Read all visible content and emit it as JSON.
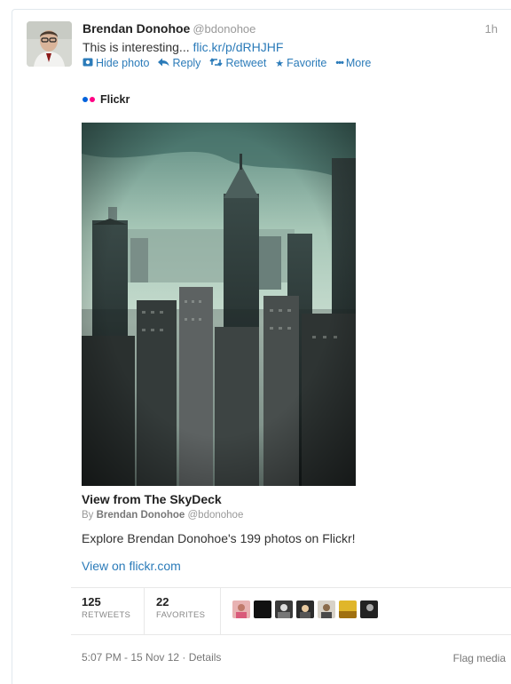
{
  "tweet": {
    "author_name": "Brendan Donohoe",
    "author_handle": "@bdonohoe",
    "time_ago": "1h",
    "text_prefix": "This is interesting... ",
    "link_text": "flic.kr/p/dRHJHF",
    "avatar_icon": "person-avatar"
  },
  "actions": {
    "hide_photo": "Hide photo",
    "reply": "Reply",
    "retweet": "Retweet",
    "favorite": "Favorite",
    "more": "More"
  },
  "card": {
    "provider": "Flickr",
    "title": "View from The SkyDeck",
    "by_prefix": "By",
    "by_name": "Brendan Donohoe",
    "by_handle": "@bdonohoe",
    "description": "Explore Brendan Donohoe's 199 photos on Flickr!",
    "view_link": "View on flickr.com"
  },
  "stats": {
    "retweets_count": "125",
    "retweets_label": "RETWEETS",
    "favorites_count": "22",
    "favorites_label": "FAVORITES"
  },
  "footer": {
    "timestamp": "5:07 PM - 15 Nov 12 · Details",
    "flag": "Flag media"
  },
  "colors": {
    "link": "#2b7bb9",
    "flickr_pink": "#ff0084",
    "flickr_blue": "#0063dc"
  }
}
